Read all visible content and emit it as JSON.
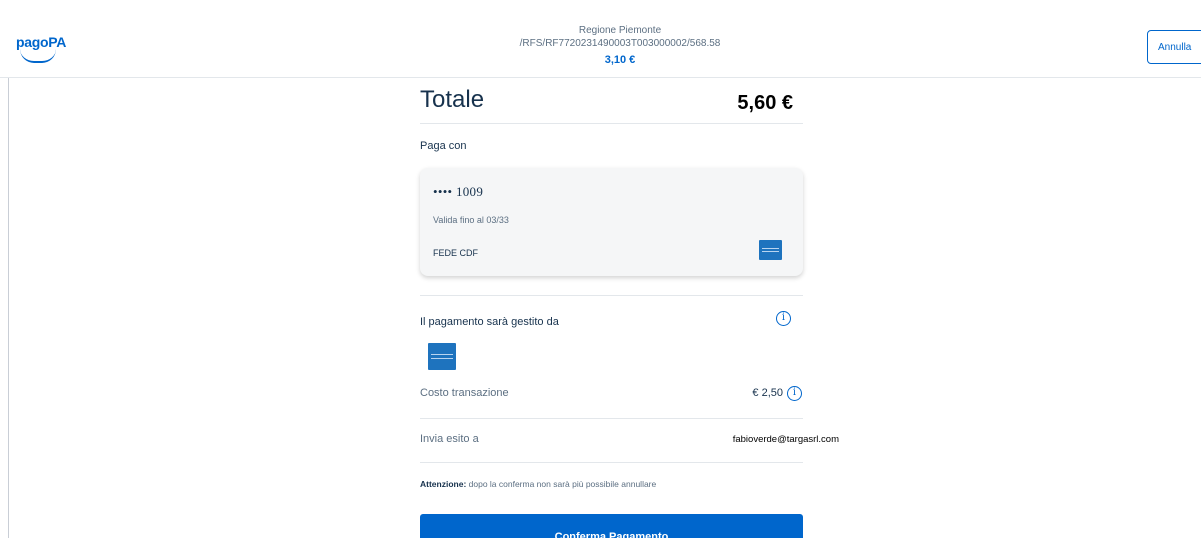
{
  "header": {
    "logo_text": "pagoPA",
    "entity": "Regione Piemonte",
    "reference": "/RFS/RF7720231490003T003000002/568.58",
    "amount": "3,10 €",
    "cancel_label": "Annulla"
  },
  "summary": {
    "total_label": "Totale",
    "total_value": "5,60 €"
  },
  "payment_method": {
    "section_label": "Paga con",
    "card_number": "•••• 1009",
    "expiry": "Valida fino al 03/33",
    "holder": "FEDE CDF",
    "card_brand_icon": "amex-icon"
  },
  "psp": {
    "label": "Il pagamento sarà gestito da",
    "info_icon": "info-icon",
    "logo_icon": "amex-icon",
    "fee_label": "Costo transazione",
    "fee_value": "€ 2,50"
  },
  "receipt": {
    "label": "Invia esito a",
    "email": "fabioverde@targasrl.com"
  },
  "warning": {
    "bold": "Attenzione:",
    "text": " dopo la conferma non sarà più possibile annullare"
  },
  "actions": {
    "confirm_label": "Conferma Pagamento"
  },
  "colors": {
    "primary": "#0066cc",
    "text": "#17324d",
    "muted": "#5c6f82",
    "card_bg": "#f5f6f7"
  }
}
